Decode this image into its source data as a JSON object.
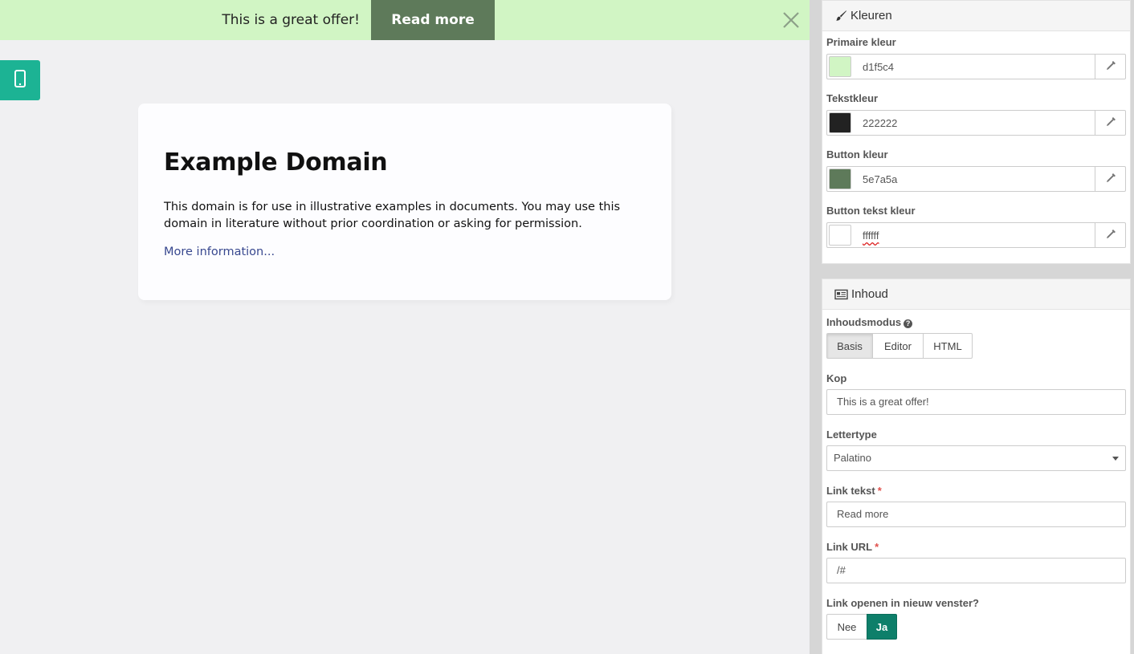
{
  "preview": {
    "offer_bar": {
      "headline": "This is a great offer!",
      "button_label": "Read more",
      "background_color": "#d1f5c4",
      "button_color": "#5e7a5a",
      "text_color": "#222222",
      "button_text_color": "#ffffff"
    },
    "device_toggle_icon": "mobile-phone-icon",
    "card": {
      "title": "Example Domain",
      "text": "This domain is for use in illustrative examples in documents. You may use this domain in literature without prior coordination or asking for permission.",
      "link": "More information..."
    }
  },
  "panel_colors": {
    "title": "Kleuren",
    "icon": "paint-brush-icon",
    "fields": [
      {
        "label": "Primaire kleur",
        "value": "d1f5c4",
        "swatch": "#d1f5c4"
      },
      {
        "label": "Tekstkleur",
        "value": "222222",
        "swatch": "#222222"
      },
      {
        "label": "Button kleur",
        "value": "5e7a5a",
        "swatch": "#5e7a5a"
      },
      {
        "label": "Button tekst kleur",
        "value": "ffffff",
        "swatch": "#ffffff"
      }
    ]
  },
  "panel_content": {
    "title": "Inhoud",
    "icon": "newspaper-icon",
    "mode": {
      "label": "Inhoudsmodus",
      "options": [
        "Basis",
        "Editor",
        "HTML"
      ],
      "selected": "Basis"
    },
    "heading": {
      "label": "Kop",
      "value": "This is a great offer!"
    },
    "font": {
      "label": "Lettertype",
      "value": "Palatino"
    },
    "link_text": {
      "label": "Link tekst",
      "value": "Read more",
      "required_mark": "*"
    },
    "link_url": {
      "label": "Link URL",
      "value": "/#",
      "required_mark": "*"
    },
    "new_window": {
      "label": "Link openen in nieuw venster?",
      "options": [
        "Nee",
        "Ja"
      ],
      "selected": "Ja"
    }
  }
}
